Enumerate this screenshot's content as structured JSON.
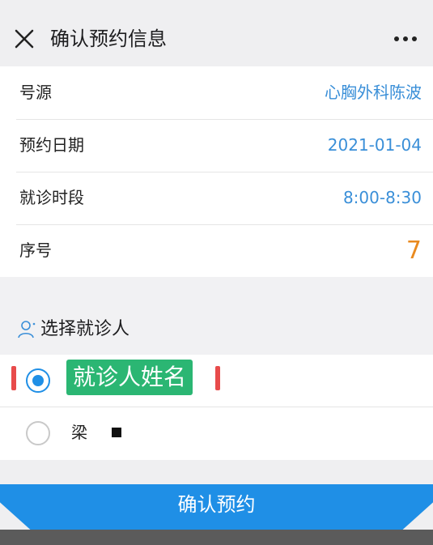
{
  "header": {
    "title": "确认预约信息",
    "close_icon": "close-icon",
    "more_icon": "more-icon"
  },
  "appointment": {
    "rows": [
      {
        "label": "号源",
        "value": "心胸外科陈波"
      },
      {
        "label": "预约日期",
        "value": "2021-01-04"
      },
      {
        "label": "就诊时段",
        "value": "8:00-8:30"
      },
      {
        "label": "序号",
        "value": "7"
      }
    ]
  },
  "patient_section": {
    "title": "选择就诊人",
    "icon": "person-icon",
    "patients": [
      {
        "name": "就诊人姓名",
        "selected": true
      },
      {
        "name": "梁",
        "selected": false
      }
    ]
  },
  "footer": {
    "confirm_label": "确认预约"
  },
  "colors": {
    "accent": "#1f8fe6",
    "value_blue": "#3a8fd8",
    "number_orange": "#e98a1f",
    "highlight_green": "#2bb673",
    "bracket_red": "#e84b4b"
  }
}
